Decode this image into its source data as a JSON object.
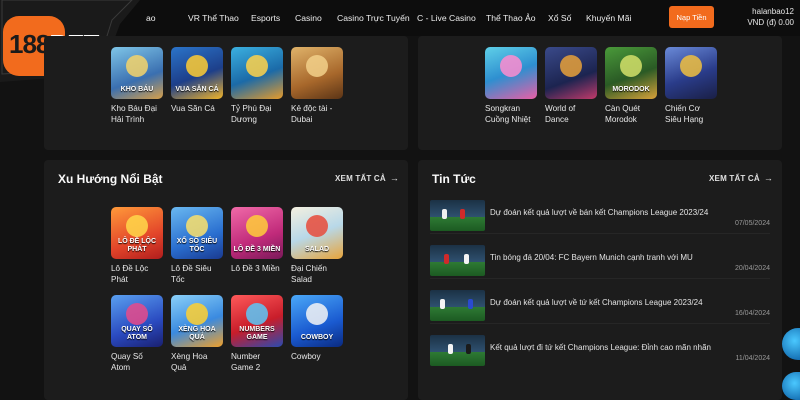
{
  "nav": {
    "items": [
      "ao",
      "VR Thể Thao",
      "Esports",
      "Casino",
      "Casino Trực Tuyến",
      "C - Live Casino",
      "Thể Thao Ảo",
      "Xổ Số",
      "Khuyến Mãi"
    ],
    "deposit_label": "Nạp Tiền",
    "username": "halanbao12",
    "balance": "VND (đ) 0.00"
  },
  "logo": {
    "num": "188",
    "brand": "BET"
  },
  "colors": {
    "accent": "#f26b1d",
    "panel": "#1c1c1c",
    "background": "#121212"
  },
  "top_left_games": [
    {
      "name": "Kho Báu Đại Hải Trình",
      "art": "KHO BÁU"
    },
    {
      "name": "Vua Săn Cá",
      "art": "VUA SĂN CÁ"
    },
    {
      "name": "Tỷ Phú Đại Dương",
      "art": ""
    },
    {
      "name": "Kẻ độc tài - Dubai",
      "art": ""
    }
  ],
  "top_right_games": [
    {
      "name": "Songkran Cuồng Nhiệt",
      "art": ""
    },
    {
      "name": "World of Dance",
      "art": ""
    },
    {
      "name": "Càn Quét Morodok",
      "art": "MORODOK"
    },
    {
      "name": "Chiến Cơ Siêu Hạng",
      "art": ""
    }
  ],
  "trending": {
    "title": "Xu Hướng Nổi Bật",
    "see_all": "XEM TẤT CẢ",
    "games": [
      {
        "name": "Lô Đề Lộc Phát",
        "art": "LÔ ĐỀ LỘC PHÁT"
      },
      {
        "name": "Lô Đề Siêu Tốc",
        "art": "XỔ SỐ SIÊU TỐC"
      },
      {
        "name": "Lô Đề 3 Miền",
        "art": "LÔ ĐỀ 3 MIỀN"
      },
      {
        "name": "Đại Chiến Salad",
        "art": "SALAD"
      },
      {
        "name": "Quay Số Atom",
        "art": "QUAY SỐ ATOM"
      },
      {
        "name": "Xèng Hoa Quả",
        "art": "XÈNG HOA QUẢ"
      },
      {
        "name": "Number Game 2",
        "art": "NUMBERS GAME"
      },
      {
        "name": "Cowboy",
        "art": "COWBOY"
      }
    ]
  },
  "news": {
    "title": "Tin Tức",
    "see_all": "XEM TẤT CẢ",
    "items": [
      {
        "title": "Dự đoán kết quả lượt về bán kết Champions League 2023/24",
        "date": "07/05/2024"
      },
      {
        "title": "Tin bóng đá 20/04: FC Bayern Munich cạnh tranh với MU",
        "date": "20/04/2024"
      },
      {
        "title": "Dự đoán kết quả lượt về tứ kết Champions League 2023/24",
        "date": "16/04/2024"
      },
      {
        "title": "Kết quả lượt đi tứ kết Champions League: Đỉnh cao mãn nhãn",
        "date": "11/04/2024"
      }
    ]
  }
}
